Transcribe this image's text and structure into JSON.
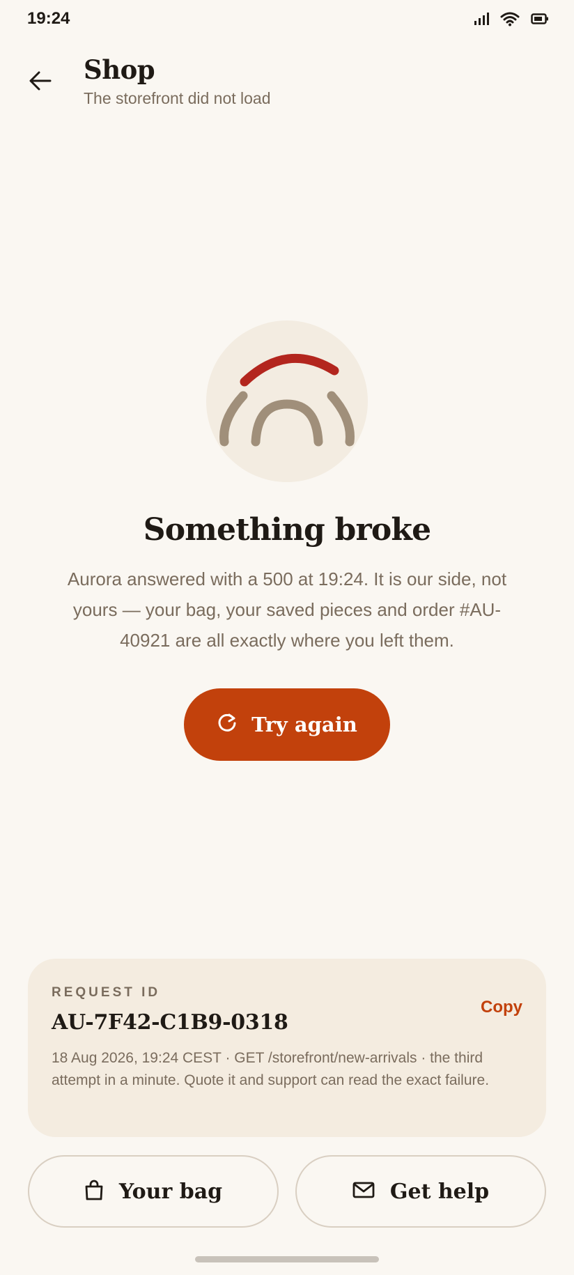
{
  "status_bar": {
    "time": "19:24",
    "icons": [
      "signal-icon",
      "wifi-icon",
      "battery-icon"
    ]
  },
  "header": {
    "back_icon": "arrow-left-icon",
    "title": "Shop",
    "subtitle": "The storefront did not load"
  },
  "error": {
    "illustration": "broken-arcs-icon",
    "title": "Something broke",
    "body": "Aurora answered with a 500 at 19:24. It is our side, not yours — your bag, your saved pieces and order #AU-40921 are all exactly where you left them.",
    "retry_icon": "refresh-icon",
    "retry_label": "Try again"
  },
  "request": {
    "label": "REQUEST ID",
    "id": "AU-7F42-C1B9-0318",
    "copy_label": "Copy",
    "details": "18 Aug 2026, 19:24 CEST · GET /storefront/new-arrivals · the third attempt in a minute. Quote it and support can read the exact failure."
  },
  "actions": {
    "bag_icon": "shopping-bag-icon",
    "bag_label": "Your bag",
    "help_icon": "mail-icon",
    "help_label": "Get help"
  },
  "colors": {
    "accent": "#c2410c",
    "background": "#faf7f2",
    "card": "#f4ece0",
    "muted_text": "#7a6c5d",
    "arc_alert": "#b3261e",
    "arc_neutral": "#a08f7a"
  }
}
